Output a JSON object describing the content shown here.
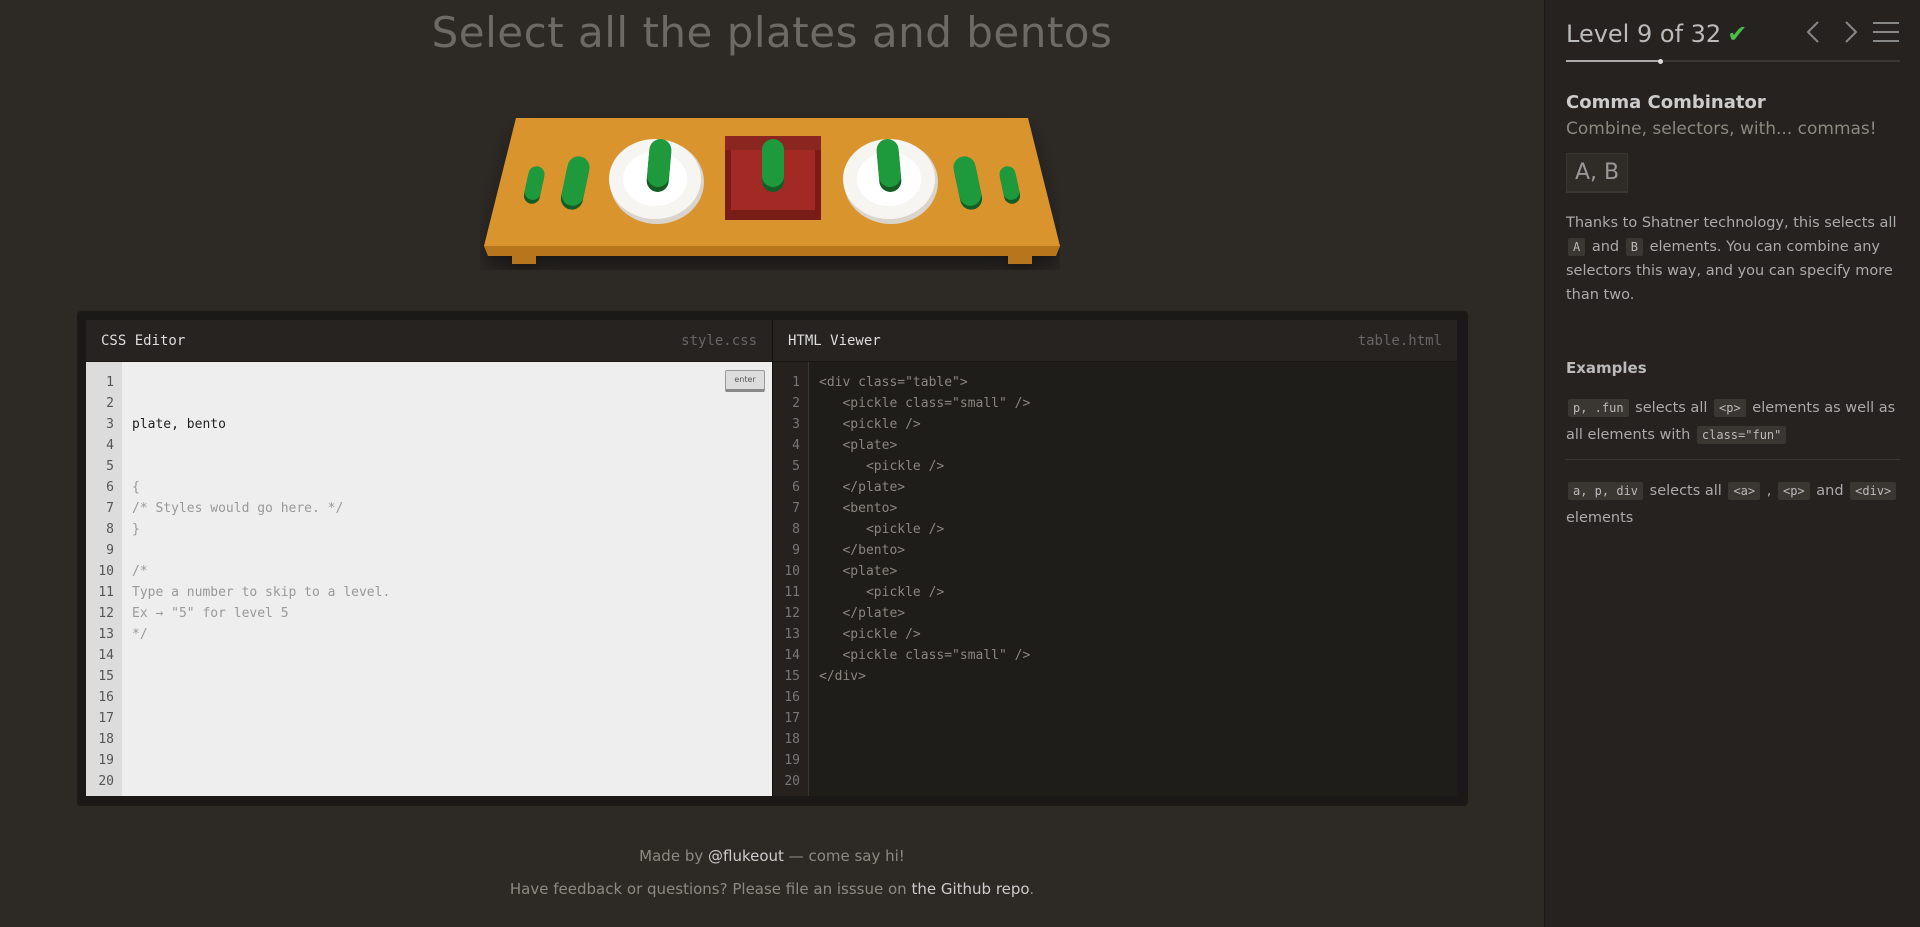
{
  "order": "Select all the plates and bentos",
  "editor": {
    "css_title": "CSS Editor",
    "css_file": "style.css",
    "enter_label": "enter",
    "input_value": "plate, bento",
    "css_lines": [
      "{",
      "/* Styles would go here. */",
      "}",
      "",
      "/*",
      "Type a number to skip to a level.",
      "Ex → \"5\" for level 5",
      "*/"
    ],
    "html_title": "HTML Viewer",
    "html_file": "table.html",
    "html_lines": [
      "<div class=\"table\">",
      "   <pickle class=\"small\" />",
      "   <pickle />",
      "   <plate>",
      "      <pickle />",
      "   </plate>",
      "   <bento>",
      "      <pickle />",
      "   </bento>",
      "   <plate>",
      "      <pickle />",
      "   </plate>",
      "   <pickle />",
      "   <pickle class=\"small\" />",
      "</div>"
    ],
    "line_count": 20
  },
  "footer": {
    "line1_prefix": "Made by ",
    "line1_link": "@flukeout",
    "line1_suffix": " — come say hi!",
    "line2_prefix": "Have feedback or questions? Please file an isssue on ",
    "line2_link": "the Github repo",
    "line2_suffix": "."
  },
  "sidebar": {
    "level_label": "Level 9 of 32",
    "check_icon": "✔",
    "level_progress": 0.28,
    "title": "Comma Combinator",
    "subtitle": "Combine, selectors, with... commas!",
    "syntax": "A, B",
    "hint_pre": "Thanks to Shatner technology, this selects all ",
    "hint_tag_a": "A",
    "hint_and": " and ",
    "hint_tag_b": "B",
    "hint_post": " elements. You can combine any selectors this way, and you can specify more than two.",
    "examples_title": "Examples",
    "example1": {
      "code": "p, .fun",
      "t1": " selects all ",
      "tag1": "<p>",
      "t2": " elements as well as all elements with ",
      "tag2": "class=\"fun\""
    },
    "example2": {
      "code": "a, p, div",
      "t1": " selects all ",
      "tag1": "<a>",
      "t2": " , ",
      "tag2": "<p>",
      "t3": " and ",
      "tag3": "<div>",
      "t4": " elements"
    }
  },
  "colors": {
    "background": "#2d2a26",
    "sidebar": "#25221f",
    "table": "#d9942e",
    "pickle": "#1e9a3c",
    "bento": "#a32a24",
    "check": "#4cbb4a"
  }
}
